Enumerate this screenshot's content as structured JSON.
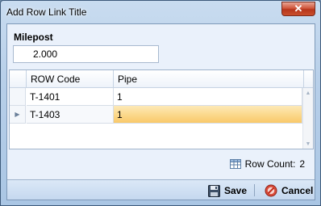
{
  "window": {
    "title": "Add Row Link Title",
    "close_glyph": "✕"
  },
  "milepost": {
    "label": "Milepost",
    "value": "2.000"
  },
  "grid": {
    "columns": [
      "ROW Code",
      "Pipe"
    ],
    "rows": [
      {
        "row_code": "T-1401",
        "pipe": "1"
      },
      {
        "row_code": "T-1403",
        "pipe": "1"
      }
    ],
    "current_row_indicator": "▶"
  },
  "row_count": {
    "label": "Row Count:",
    "value": "2"
  },
  "footer": {
    "save_label": "Save",
    "cancel_label": "Cancel"
  },
  "colors": {
    "selection": "#fbd88a",
    "accent": "#aac6e4"
  }
}
